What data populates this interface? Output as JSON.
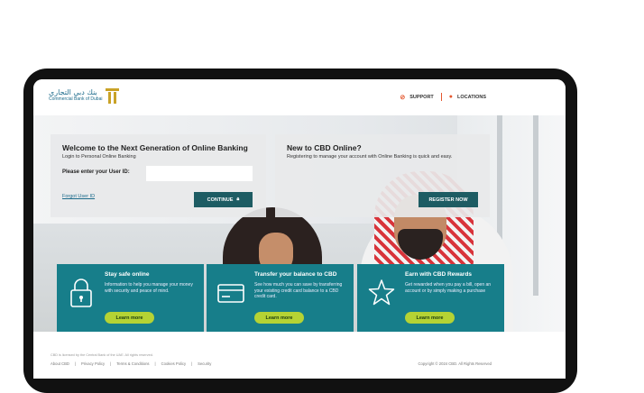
{
  "brand": {
    "arabic": "بنك دبي التجاري",
    "english": "Commercial Bank of Dubai"
  },
  "header": {
    "support": "SUPPORT",
    "locations": "LOCATIONS"
  },
  "login": {
    "title": "Welcome to the Next Generation of Online Banking",
    "subtitle": "Login to Personal Online Banking",
    "user_id_label": "Please enter your User ID:",
    "user_id_value": "",
    "forgot": "Forgot User ID",
    "continue": "CONTINUE"
  },
  "new_user": {
    "title": "New to CBD Online?",
    "subtitle": "Registering to manage your account with Online Banking is quick and easy.",
    "register": "REGISTER NOW"
  },
  "cards": [
    {
      "title": "Stay safe online",
      "desc": "Information to help you manage your money with security and peace of mind.",
      "button": "Learn more",
      "icon": "padlock-icon"
    },
    {
      "title": "Transfer your balance to CBD",
      "desc": "See how much you can save by transferring your existing credit card balance to a CBD credit card.",
      "button": "Learn more",
      "icon": "credit-card-icon"
    },
    {
      "title": "Earn with CBD Rewards",
      "desc": "Get rewarded when you pay a bill, open an account or by simply making a purchase",
      "button": "Learn more",
      "icon": "star-icon"
    }
  ],
  "footer": {
    "note": "CBD is licensed by the Central Bank of the UAE. All rights reserved.",
    "links": [
      "About CBD",
      "Privacy Policy",
      "Terms & Conditions",
      "Cookies Policy",
      "Security"
    ],
    "copyright": "Copyright © 2024 CBD. All Rights Reserved"
  },
  "colors": {
    "teal_dark": "#1d5c63",
    "teal_card": "#177e8a",
    "lime": "#b5d334",
    "accent": "#e4572e"
  }
}
